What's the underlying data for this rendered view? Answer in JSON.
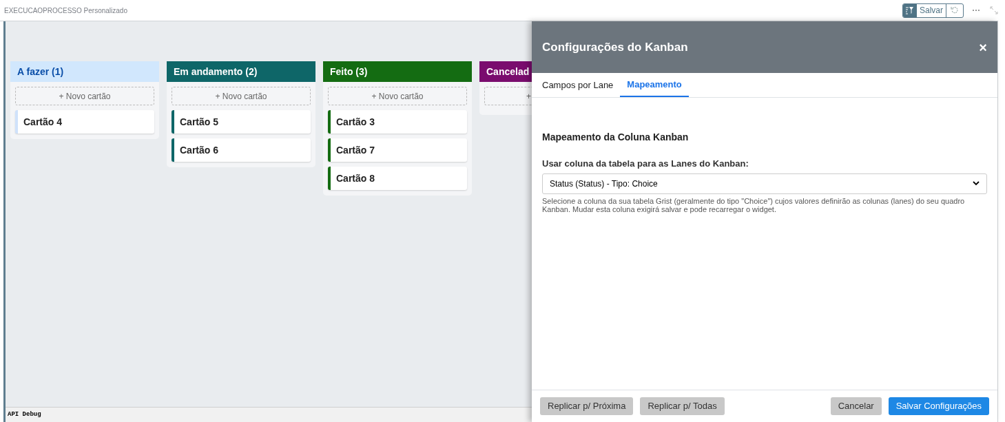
{
  "window": {
    "title": "EXECUCAOPROCESSO Personalizado",
    "save_label": "Salvar"
  },
  "lanes": [
    {
      "title": "A fazer (1)",
      "color": "#d1e7fd",
      "add_label": "+ Novo cartão",
      "cut": false,
      "cards": [
        "Cartão 4"
      ]
    },
    {
      "title": "Em andamento (2)",
      "color": "#0e6668",
      "add_label": "+ Novo cartão",
      "cut": false,
      "cards": [
        "Cartão 5",
        "Cartão 6"
      ]
    },
    {
      "title": "Feito (3)",
      "color": "#146c12",
      "add_label": "+ Novo cartão",
      "cut": false,
      "cards": [
        "Cartão 3",
        "Cartão 7",
        "Cartão 8"
      ]
    },
    {
      "title": "Cancelad",
      "color": "#7a0c6e",
      "add_label": "+",
      "cut": true
    }
  ],
  "debug_label": "API Debug",
  "panel": {
    "title": "Configurações do Kanban",
    "close": "×",
    "tabs": [
      {
        "label": "Campos por Lane",
        "selected": false
      },
      {
        "label": "Mapeamento",
        "selected": true
      }
    ],
    "section_title": "Mapeamento da Coluna Kanban",
    "field_label": "Usar coluna da tabela para as Lanes do Kanban:",
    "select_value": "Status (Status) - Tipo: Choice",
    "help": "Selecione a coluna da sua tabela Grist (geralmente do tipo \"Choice\") cujos valores definirão as colunas (lanes) do seu quadro Kanban. Mudar esta coluna exigirá salvar e pode recarregar o widget.",
    "buttons": [
      {
        "label": "Replicar p/ Próxima",
        "kind": "secondary"
      },
      {
        "label": "Replicar p/ Todas",
        "kind": "secondary"
      },
      {
        "label": "Cancelar",
        "kind": "secondary"
      },
      {
        "label": "Salvar Configurações",
        "kind": "primary"
      }
    ]
  }
}
